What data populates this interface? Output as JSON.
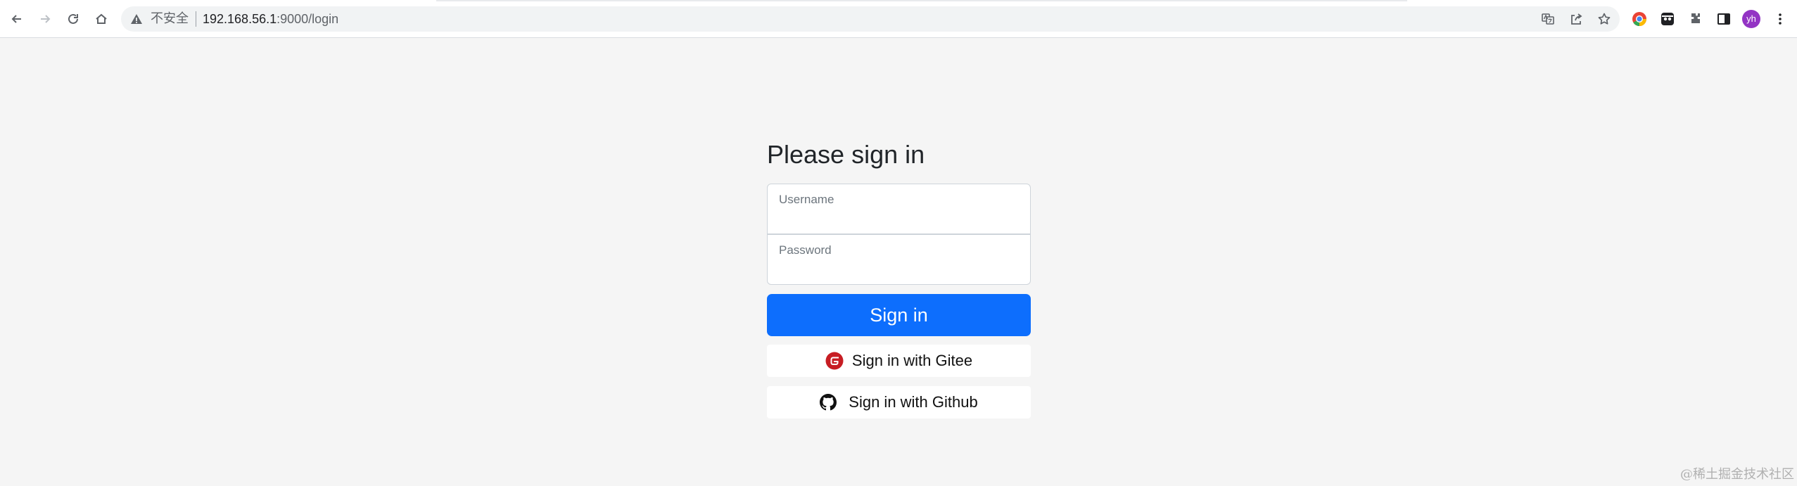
{
  "browser": {
    "security_label": "不安全",
    "url_host": "192.168.56.1",
    "url_path": ":9000/login",
    "avatar_initials": "yh",
    "icons": {
      "back": "arrow-left-icon",
      "forward": "arrow-right-icon",
      "reload": "reload-icon",
      "home": "home-icon",
      "warning": "warning-triangle-icon",
      "translate": "translate-icon",
      "share": "share-icon",
      "bookmark": "star-icon",
      "extensions": "puzzle-icon",
      "side_panel": "side-panel-icon",
      "menu": "kebab-menu-icon"
    }
  },
  "login": {
    "heading": "Please sign in",
    "username_placeholder": "Username",
    "password_placeholder": "Password",
    "signin_label": "Sign in",
    "gitee_label": "Sign in with Gitee",
    "github_label": "Sign in with Github",
    "primary_color": "#0d6efd",
    "gitee_color": "#c71d23"
  },
  "watermark": "@稀土掘金技术社区"
}
